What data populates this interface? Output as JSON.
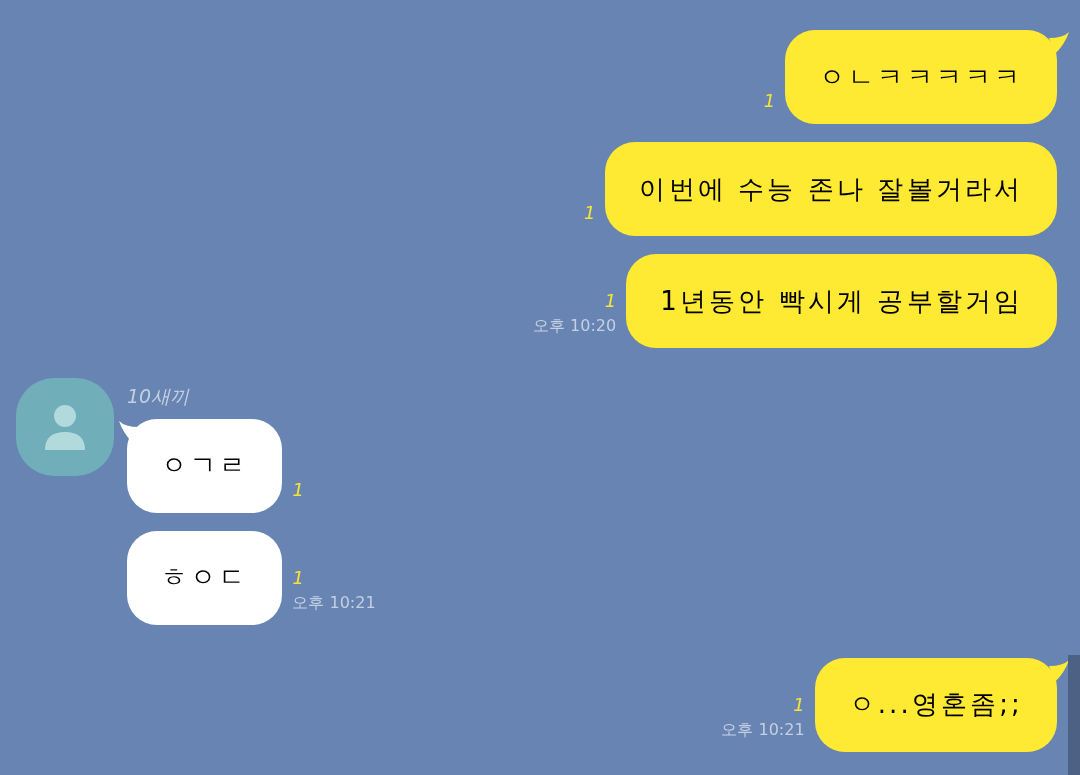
{
  "groups": [
    {
      "kind": "outgoing",
      "messages": [
        {
          "text": "ㅇㄴㅋㅋㅋㅋㅋ",
          "unread": "1"
        },
        {
          "text": "이번에 수능 존나 잘볼거라서",
          "unread": "1"
        },
        {
          "text": "1년동안 빡시게 공부할거임",
          "unread": "1"
        }
      ],
      "time": "오후 10:20"
    },
    {
      "kind": "incoming",
      "name": "10새끼",
      "messages": [
        {
          "text": "ㅇㄱㄹ",
          "unread": "1"
        },
        {
          "text": "ㅎㅇㄷ",
          "unread": "1"
        }
      ],
      "time": "오후 10:21"
    },
    {
      "kind": "outgoing",
      "messages": [
        {
          "text": "ㅇ...영혼좀;;",
          "unread": "1"
        }
      ],
      "time": "오후 10:21"
    }
  ]
}
